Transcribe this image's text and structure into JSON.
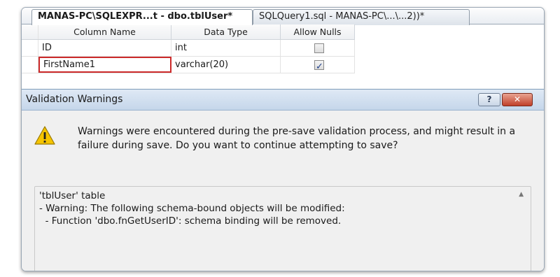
{
  "tabs": [
    {
      "label": "MANAS-PC\\SQLEXPR...t - dbo.tblUser*",
      "active": true
    },
    {
      "label": "SQLQuery1.sql - MANAS-PC\\...\\...2))*",
      "active": false
    }
  ],
  "grid": {
    "headers": [
      "Column Name",
      "Data Type",
      "Allow Nulls"
    ],
    "rows": [
      {
        "name": "ID",
        "type": "int",
        "allow_nulls": false
      },
      {
        "name": "FirstName1",
        "type": "varchar(20)",
        "allow_nulls": true
      }
    ]
  },
  "dialog": {
    "title": "Validation Warnings",
    "help_label": "?",
    "close_label": "✕",
    "message": "Warnings were encountered during the pre-save validation process, and might result in a failure during save. Do you want to continue attempting to save?",
    "details": {
      "line1": "'tblUser' table",
      "line2": "- Warning: The following schema-bound objects will be modified:",
      "line3": "  - Function 'dbo.fnGetUserID': schema binding will be removed."
    }
  },
  "colors": {
    "accent": "#cc2a2a",
    "titlebar": "#c5d6ea",
    "warning_icon": "#f5c400"
  }
}
